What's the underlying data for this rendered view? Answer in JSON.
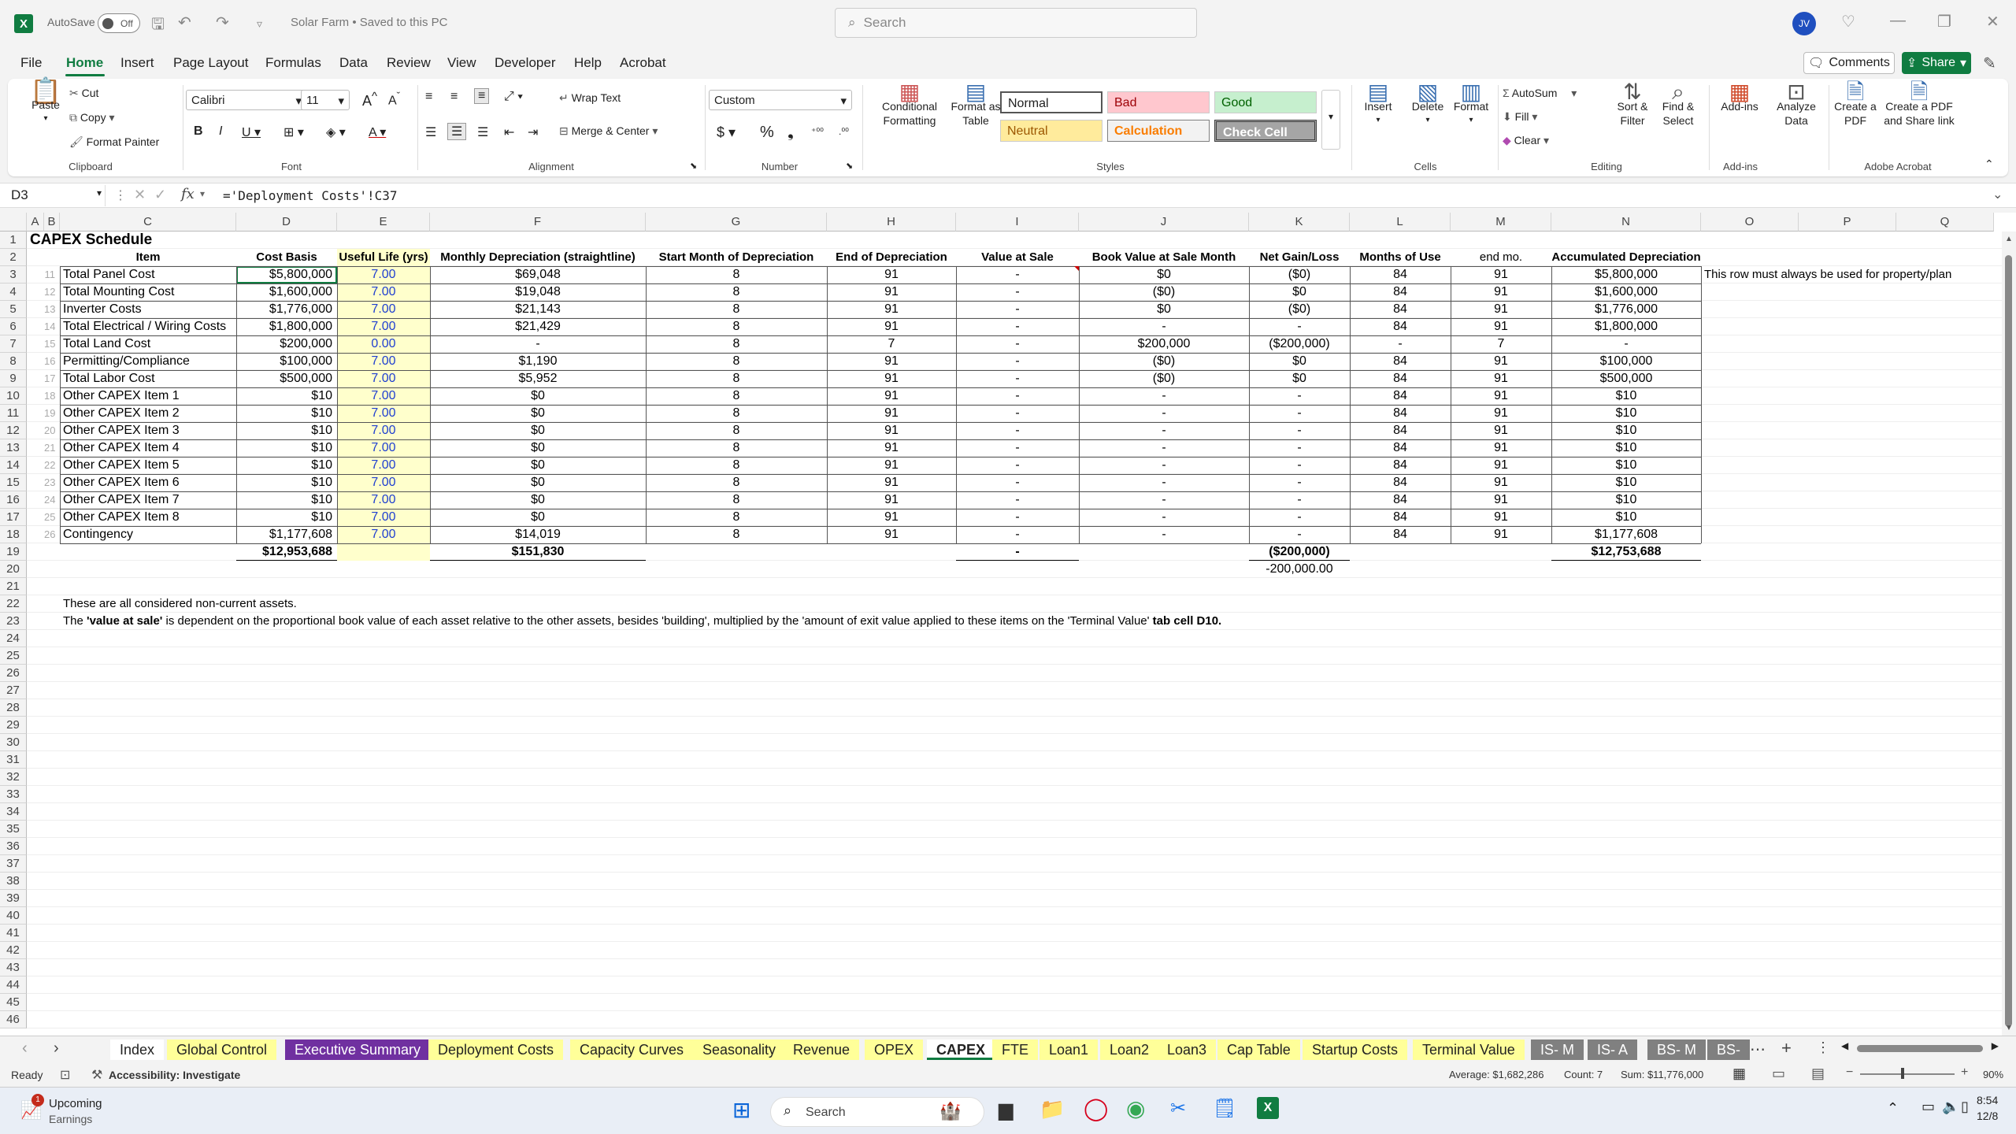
{
  "titlebar": {
    "autosave": "AutoSave",
    "toggle": "Off",
    "doc_title": "Solar Farm • Saved to this PC",
    "search_placeholder": "Search",
    "avatar_initials": "JV"
  },
  "menu": {
    "items": [
      "File",
      "Home",
      "Insert",
      "Page Layout",
      "Formulas",
      "Data",
      "Review",
      "View",
      "Developer",
      "Help",
      "Acrobat"
    ],
    "active": "Home",
    "comments": "Comments",
    "share": "Share"
  },
  "ribbon": {
    "clipboard": {
      "label": "Clipboard",
      "paste": "Paste",
      "cut": "Cut",
      "copy": "Copy",
      "format_painter": "Format Painter"
    },
    "font": {
      "label": "Font",
      "family": "Calibri",
      "size": "11"
    },
    "alignment": {
      "label": "Alignment",
      "wrap": "Wrap Text",
      "merge": "Merge & Center"
    },
    "number": {
      "label": "Number",
      "format": "Custom"
    },
    "styles": {
      "label": "Styles",
      "conditional": "Conditional Formatting",
      "format_table": "Format as Table",
      "normal": "Normal",
      "bad": "Bad",
      "good": "Good",
      "neutral": "Neutral",
      "calculation": "Calculation",
      "check_cell": "Check Cell"
    },
    "cells": {
      "label": "Cells",
      "insert": "Insert",
      "delete": "Delete",
      "format": "Format"
    },
    "editing": {
      "label": "Editing",
      "autosum": "AutoSum",
      "fill": "Fill",
      "clear": "Clear",
      "sort": "Sort & Filter",
      "find": "Find & Select"
    },
    "addins": {
      "label": "Add-ins",
      "addins": "Add-ins",
      "analyze": "Analyze Data"
    },
    "acrobat": {
      "label": "Adobe Acrobat",
      "create_pdf": "Create a PDF",
      "create_share": "Create a PDF and Share link"
    }
  },
  "formula_bar": {
    "namebox": "D3",
    "formula": "='Deployment Costs'!C37"
  },
  "columns": [
    "A",
    "B",
    "C",
    "D",
    "E",
    "F",
    "G",
    "H",
    "I",
    "J",
    "K",
    "L",
    "M",
    "N",
    "O",
    "P",
    "Q"
  ],
  "sheet": {
    "title": "CAPEX Schedule",
    "headers": [
      "Item",
      "Cost Basis",
      "Useful Life (yrs)",
      "Monthly Depreciation (straightline)",
      "Start Month of Depreciation",
      "End of Depreciation",
      "Value at Sale",
      "Book Value at Sale Month",
      "Net Gain/Loss",
      "Months of Use",
      "end mo.",
      "Accumulated Depreciation"
    ],
    "rows": [
      {
        "ref": "11",
        "item": "Total Panel Cost",
        "cost": "$5,800,000",
        "life": "7.00",
        "dep": "$69,048",
        "start": "8",
        "end": "91",
        "sale": "-",
        "book": "$0",
        "gain": "($0)",
        "months": "84",
        "endmo": "91",
        "accum": "$5,800,000"
      },
      {
        "ref": "12",
        "item": "Total Mounting Cost",
        "cost": "$1,600,000",
        "life": "7.00",
        "dep": "$19,048",
        "start": "8",
        "end": "91",
        "sale": "-",
        "book": "($0)",
        "gain": "$0",
        "months": "84",
        "endmo": "91",
        "accum": "$1,600,000"
      },
      {
        "ref": "13",
        "item": "Inverter Costs",
        "cost": "$1,776,000",
        "life": "7.00",
        "dep": "$21,143",
        "start": "8",
        "end": "91",
        "sale": "-",
        "book": "$0",
        "gain": "($0)",
        "months": "84",
        "endmo": "91",
        "accum": "$1,776,000"
      },
      {
        "ref": "14",
        "item": "Total Electrical / Wiring Costs",
        "cost": "$1,800,000",
        "life": "7.00",
        "dep": "$21,429",
        "start": "8",
        "end": "91",
        "sale": "-",
        "book": "-",
        "gain": "-",
        "months": "84",
        "endmo": "91",
        "accum": "$1,800,000"
      },
      {
        "ref": "15",
        "item": "Total Land Cost",
        "cost": "$200,000",
        "life": "0.00",
        "dep": "-",
        "start": "8",
        "end": "7",
        "sale": "-",
        "book": "$200,000",
        "gain": "($200,000)",
        "months": "-",
        "endmo": "7",
        "accum": "-"
      },
      {
        "ref": "16",
        "item": "Permitting/Compliance",
        "cost": "$100,000",
        "life": "7.00",
        "dep": "$1,190",
        "start": "8",
        "end": "91",
        "sale": "-",
        "book": "($0)",
        "gain": "$0",
        "months": "84",
        "endmo": "91",
        "accum": "$100,000"
      },
      {
        "ref": "17",
        "item": "Total Labor Cost",
        "cost": "$500,000",
        "life": "7.00",
        "dep": "$5,952",
        "start": "8",
        "end": "91",
        "sale": "-",
        "book": "($0)",
        "gain": "$0",
        "months": "84",
        "endmo": "91",
        "accum": "$500,000"
      },
      {
        "ref": "18",
        "item": "Other CAPEX Item 1",
        "cost": "$10",
        "life": "7.00",
        "dep": "$0",
        "start": "8",
        "end": "91",
        "sale": "-",
        "book": "-",
        "gain": "-",
        "months": "84",
        "endmo": "91",
        "accum": "$10"
      },
      {
        "ref": "19",
        "item": "Other CAPEX Item 2",
        "cost": "$10",
        "life": "7.00",
        "dep": "$0",
        "start": "8",
        "end": "91",
        "sale": "-",
        "book": "-",
        "gain": "-",
        "months": "84",
        "endmo": "91",
        "accum": "$10"
      },
      {
        "ref": "20",
        "item": "Other CAPEX Item 3",
        "cost": "$10",
        "life": "7.00",
        "dep": "$0",
        "start": "8",
        "end": "91",
        "sale": "-",
        "book": "-",
        "gain": "-",
        "months": "84",
        "endmo": "91",
        "accum": "$10"
      },
      {
        "ref": "21",
        "item": "Other CAPEX Item 4",
        "cost": "$10",
        "life": "7.00",
        "dep": "$0",
        "start": "8",
        "end": "91",
        "sale": "-",
        "book": "-",
        "gain": "-",
        "months": "84",
        "endmo": "91",
        "accum": "$10"
      },
      {
        "ref": "22",
        "item": "Other CAPEX Item 5",
        "cost": "$10",
        "life": "7.00",
        "dep": "$0",
        "start": "8",
        "end": "91",
        "sale": "-",
        "book": "-",
        "gain": "-",
        "months": "84",
        "endmo": "91",
        "accum": "$10"
      },
      {
        "ref": "23",
        "item": "Other CAPEX Item 6",
        "cost": "$10",
        "life": "7.00",
        "dep": "$0",
        "start": "8",
        "end": "91",
        "sale": "-",
        "book": "-",
        "gain": "-",
        "months": "84",
        "endmo": "91",
        "accum": "$10"
      },
      {
        "ref": "24",
        "item": "Other CAPEX Item 7",
        "cost": "$10",
        "life": "7.00",
        "dep": "$0",
        "start": "8",
        "end": "91",
        "sale": "-",
        "book": "-",
        "gain": "-",
        "months": "84",
        "endmo": "91",
        "accum": "$10"
      },
      {
        "ref": "25",
        "item": "Other CAPEX Item 8",
        "cost": "$10",
        "life": "7.00",
        "dep": "$0",
        "start": "8",
        "end": "91",
        "sale": "-",
        "book": "-",
        "gain": "-",
        "months": "84",
        "endmo": "91",
        "accum": "$10"
      },
      {
        "ref": "26",
        "item": "Contingency",
        "cost": "$1,177,608",
        "life": "7.00",
        "dep": "$14,019",
        "start": "8",
        "end": "91",
        "sale": "-",
        "book": "-",
        "gain": "-",
        "months": "84",
        "endmo": "91",
        "accum": "$1,177,608"
      }
    ],
    "totals": {
      "cost": "$12,953,688",
      "dep": "$151,830",
      "sale": "-",
      "gain": "($200,000)",
      "accum": "$12,753,688"
    },
    "row20_gain": "-200,000.00",
    "o3_note": "This row must always be used for property/plan",
    "note1": "These are all considered non-current assets.",
    "note2_a": "The ",
    "note2_b": "'value at sale'",
    "note2_c": " is dependent on the proportional book value of each asset relative to the other assets, besides 'building', multiplied by the 'amount of exit value applied to these items on the 'Terminal Value'",
    "note2_d": " tab cell D10."
  },
  "tabs": [
    "Index",
    "Global Control",
    "Executive Summary",
    "Deployment Costs",
    "Capacity Curves",
    "Seasonality",
    "Revenue",
    "OPEX",
    "CAPEX",
    "FTE",
    "Loan1",
    "Loan2",
    "Loan3",
    "Cap Table",
    "Startup Costs",
    "Terminal Value",
    "IS- M",
    "IS- A",
    "BS- M",
    "BS-"
  ],
  "active_tab": "CAPEX",
  "status": {
    "ready": "Ready",
    "accessibility": "Accessibility: Investigate",
    "average": "Average: $1,682,286",
    "count": "Count: 7",
    "sum": "Sum: $11,776,000",
    "zoom": "90%"
  },
  "taskbar": {
    "widget_title": "Upcoming",
    "widget_sub": "Earnings",
    "badge": "1",
    "search": "Search",
    "time": "8:54",
    "date": "12/8"
  },
  "colors": {
    "excel_green": "#107c41",
    "input_yellow": "#ffffcc",
    "input_blue": "#1f3fd0",
    "exec_tab": "#7030a0",
    "yellow_tab": "#ffff99",
    "grey_tab": "#808080"
  }
}
